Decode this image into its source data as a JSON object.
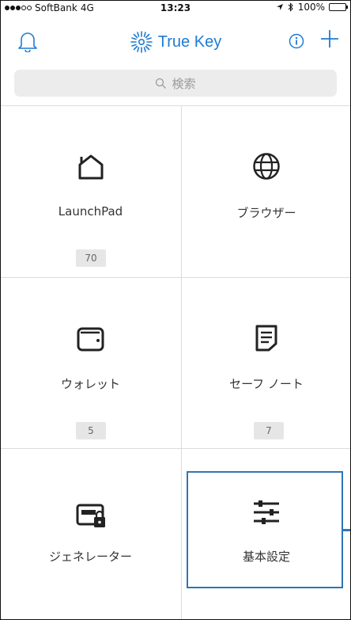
{
  "status_bar": {
    "carrier": "SoftBank",
    "network": "4G",
    "time": "13:23",
    "battery_text": "100%"
  },
  "nav": {
    "app_title": "True Key",
    "accent_color": "#1f7bd1"
  },
  "search": {
    "placeholder": "検索"
  },
  "tiles": [
    {
      "label": "LaunchPad",
      "badge": "70",
      "icon": "home-icon"
    },
    {
      "label": "ブラウザー",
      "badge": "",
      "icon": "globe-icon"
    },
    {
      "label": "ウォレット",
      "badge": "5",
      "icon": "wallet-icon"
    },
    {
      "label": "セーフ ノート",
      "badge": "7",
      "icon": "note-icon"
    },
    {
      "label": "ジェネレーター",
      "badge": "",
      "icon": "password-generator-icon"
    },
    {
      "label": "基本設定",
      "badge": "",
      "icon": "sliders-icon"
    }
  ],
  "highlight_color": "#2f75b5"
}
